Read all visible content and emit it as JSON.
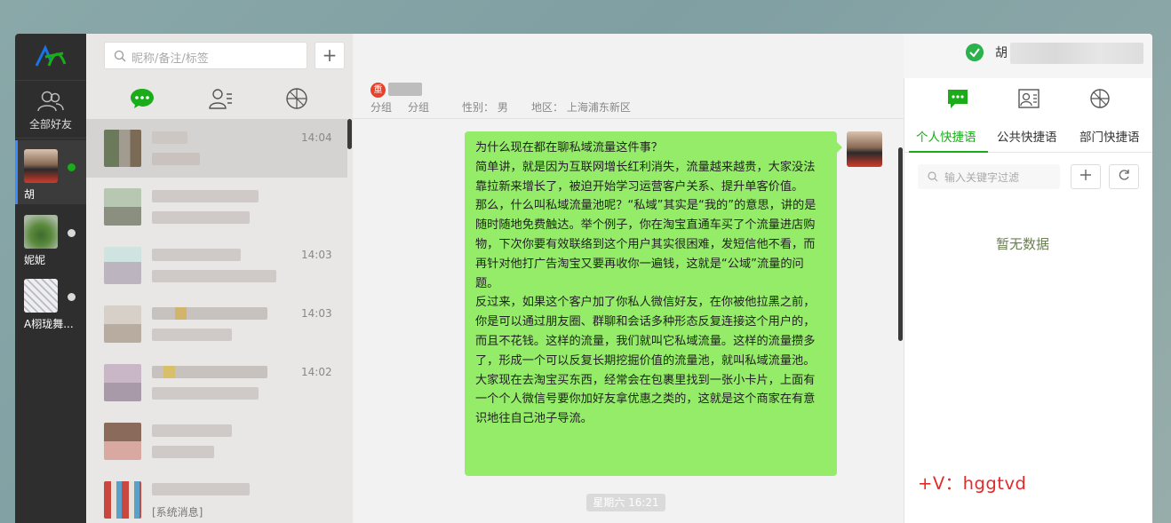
{
  "sidebar": {
    "all_friends_label": "全部好友",
    "accounts": [
      {
        "name": "胡",
        "status_color": "#1aad19",
        "active": true
      },
      {
        "name": "妮妮",
        "status_color": "#d9d9d9",
        "active": false
      },
      {
        "name": "A栩珑舞...",
        "status_color": "#d9d9d9",
        "active": false
      }
    ]
  },
  "list": {
    "search_placeholder": "昵称/备注/标签",
    "add_label": "+",
    "rows": [
      {
        "time": "14:04"
      },
      {
        "time": ""
      },
      {
        "time": "14:03"
      },
      {
        "time": "14:03"
      },
      {
        "time": "14:02"
      },
      {
        "time": ""
      },
      {
        "time": "",
        "preview": "[系统消息]"
      }
    ]
  },
  "topbar": {
    "user_name": "胡"
  },
  "chat": {
    "vip_badge": "重",
    "meta": {
      "group": "分组",
      "group2": "分组",
      "gender": "性别：  男",
      "region": "地区：  上海浦东新区"
    },
    "message_paragraphs": [
      "为什么现在都在聊私域流量这件事？",
      "简单讲，就是因为互联网增长红利消失，流量越来越贵，大家没法靠拉新来增长了，被迫开始学习运营客户关系、提升单客价值。",
      "那么，什么叫私域流量池呢？“私域”其实是“我的”的意思，讲的是随时随地免费触达。举个例子，你在淘宝直通车买了个流量进店购物，下次你要有效联络到这个用户其实很困难，发短信他不看，而再针对他打广告淘宝又要再收你一遍钱，这就是“公域”流量的问题。",
      "反过来，如果这个客户加了你私人微信好友，在你被他拉黑之前，你是可以通过朋友圈、群聊和会话多种形态反复连接这个用户的，而且不花钱。这样的流量，我们就叫它私域流量。这样的流量攒多了，形成一个可以反复长期挖掘价值的流量池，就叫私域流量池。",
      "大家现在去淘宝买东西，经常会在包裹里找到一张小卡片，上面有一个个人微信号要你加好友拿优惠之类的，这就是这个商家在有意识地往自己池子导流。"
    ],
    "day_tag": "星期六 16:21"
  },
  "right_panel": {
    "tabs": [
      "个人快捷语",
      "公共快捷语",
      "部门快捷语"
    ],
    "keyword_placeholder": "输入关键字过滤",
    "empty_text": "暂无数据",
    "accent": "#1aad19"
  },
  "watermark": "+V：hggtvd"
}
